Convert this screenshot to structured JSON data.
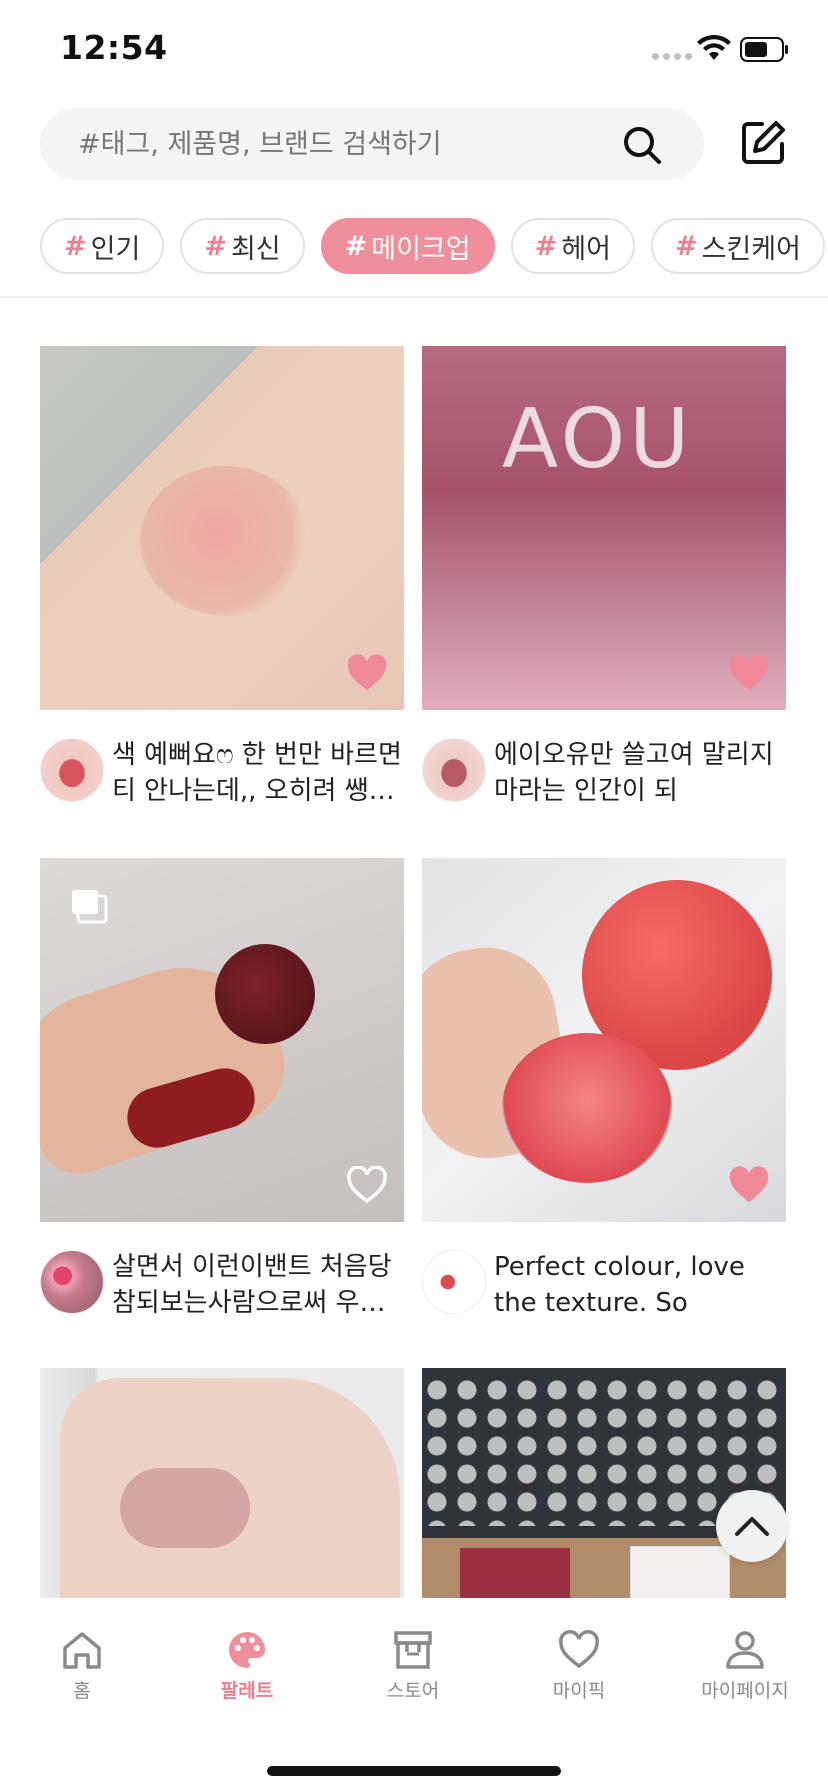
{
  "status_bar": {
    "time": "12:54"
  },
  "search": {
    "placeholder": "#태그, 제품명, 브랜드 검색하기"
  },
  "tags": [
    {
      "hash": "#",
      "label": "인기"
    },
    {
      "hash": "#",
      "label": "최신"
    },
    {
      "hash": "#",
      "label": "메이크업"
    },
    {
      "hash": "#",
      "label": "헤어"
    },
    {
      "hash": "#",
      "label": "스킨케어"
    }
  ],
  "selected_tag": "메이크업",
  "posts": [
    {
      "caption": "색 예뻐요ෆ 한 번만 바르면티 안나는데,, 오히려 쌩…",
      "liked": true,
      "image_text": ""
    },
    {
      "caption": "에이오유만 쓸고여 말리지마라는 인간이 되",
      "liked": true,
      "image_text": "AOU"
    },
    {
      "caption": "살면서 이런이밴트 처음당참되보는사람으로써 우…",
      "liked": false,
      "image_text": ""
    },
    {
      "caption": "Perfect colour, love the texture. So nourish…",
      "liked": true,
      "image_text": ""
    },
    {
      "caption": "",
      "liked": false,
      "image_text": ""
    },
    {
      "caption": "",
      "liked": false,
      "image_text": ""
    }
  ],
  "bottom_nav": {
    "items": [
      {
        "label": "홈",
        "icon": "home-icon"
      },
      {
        "label": "팔레트",
        "icon": "palette-icon"
      },
      {
        "label": "스토어",
        "icon": "store-icon"
      },
      {
        "label": "마이픽",
        "icon": "heart-icon"
      },
      {
        "label": "마이페이지",
        "icon": "person-icon"
      }
    ],
    "active": "팔레트"
  },
  "colors": {
    "accent": "#ef8f9b",
    "heart": "#f08a99",
    "text": "#222222",
    "muted": "#8a8a8a"
  }
}
